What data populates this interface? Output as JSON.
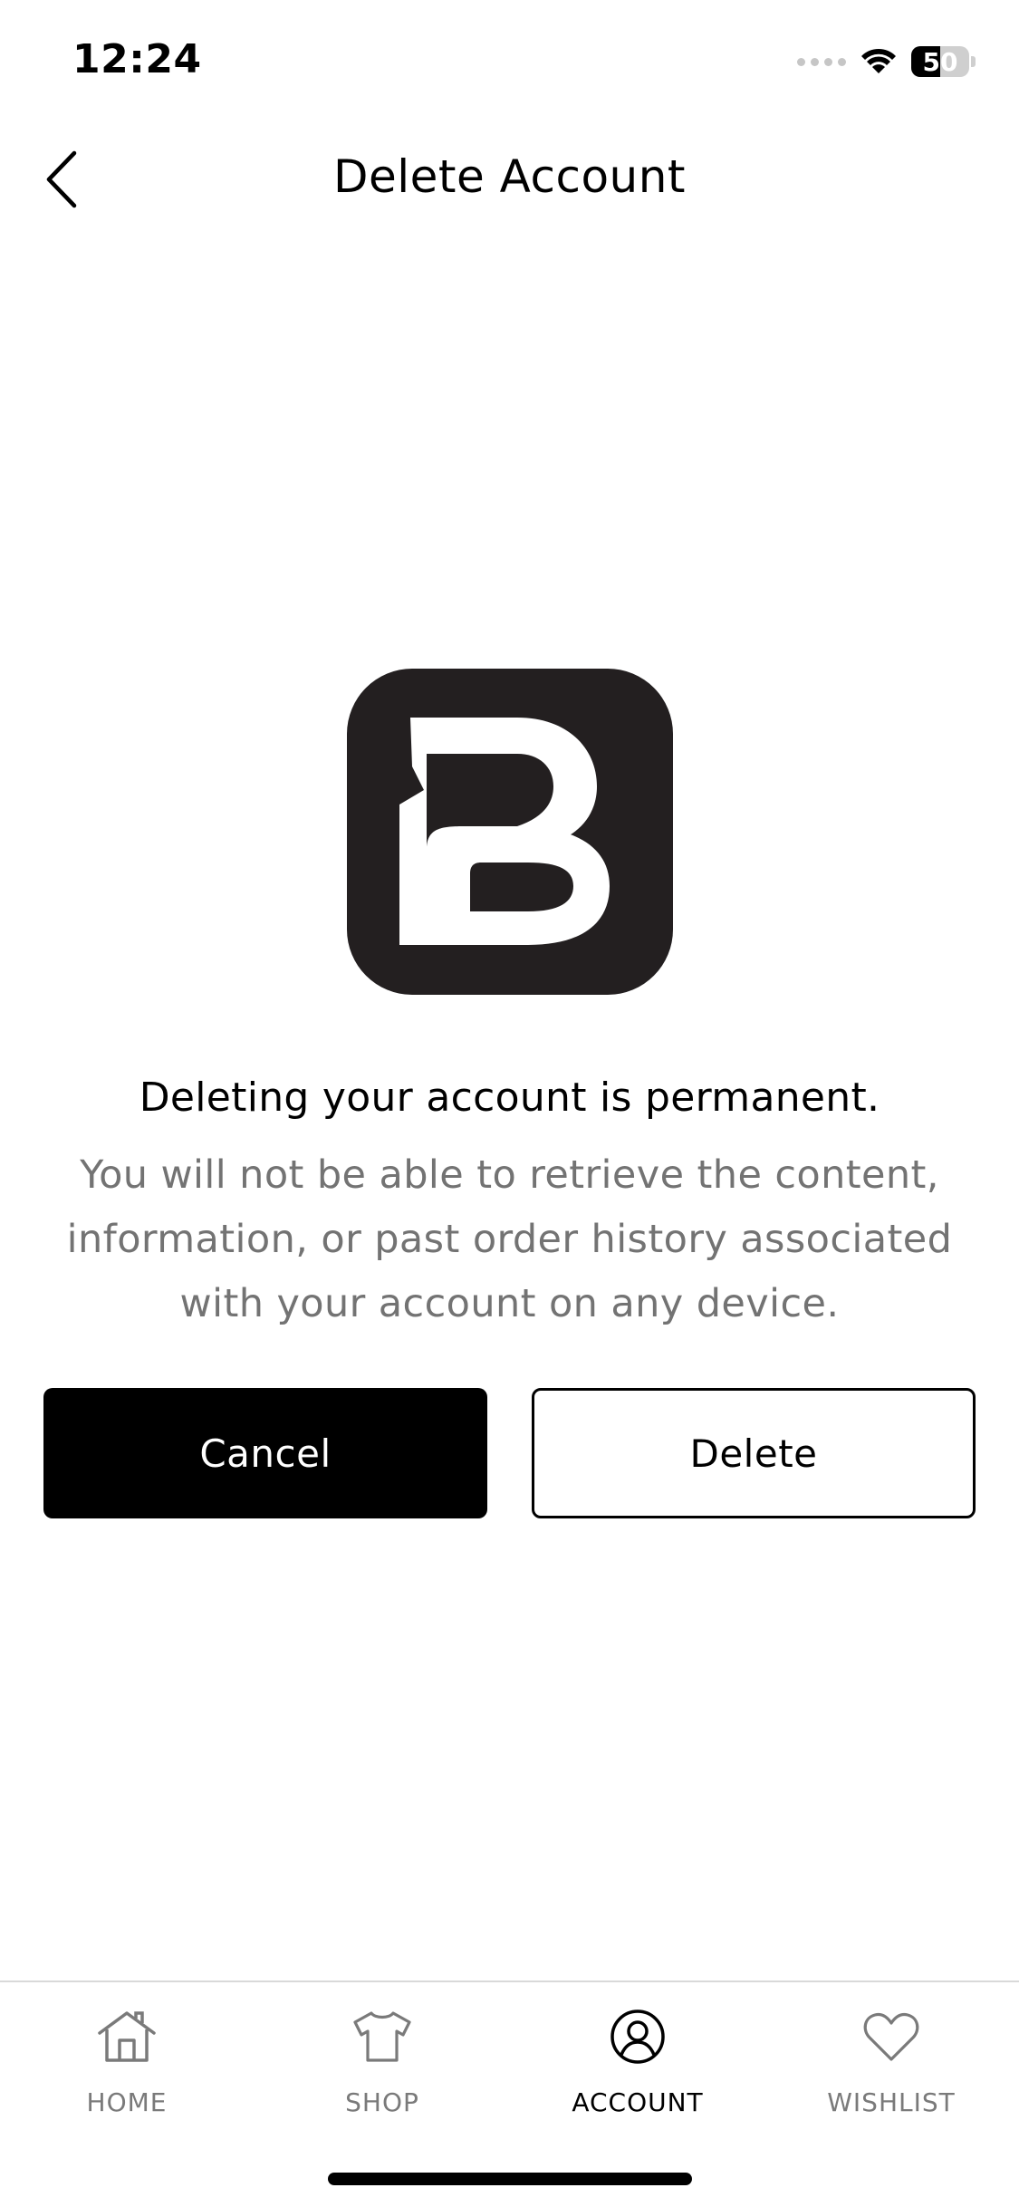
{
  "status_bar": {
    "time": "12:24",
    "battery_level": "50",
    "battery_fraction": 0.5
  },
  "header": {
    "title": "Delete Account",
    "back_icon": "chevron-left-icon"
  },
  "logo": {
    "icon": "brand-b-logo",
    "background_color": "#231f20"
  },
  "message": {
    "headline": "Deleting your account is permanent.",
    "description": "You will not be able to retrieve the content, information, or past order history associated with your account on any device."
  },
  "actions": {
    "cancel_label": "Cancel",
    "delete_label": "Delete"
  },
  "tab_bar": {
    "items": [
      {
        "label": "HOME",
        "icon": "house-icon",
        "active": false
      },
      {
        "label": "SHOP",
        "icon": "tshirt-icon",
        "active": false
      },
      {
        "label": "ACCOUNT",
        "icon": "user-circle-icon",
        "active": true
      },
      {
        "label": "WISHLIST",
        "icon": "heart-icon",
        "active": false
      }
    ]
  },
  "colors": {
    "primary": "#000000",
    "muted_text": "#737373",
    "inactive_tab": "#7a7a7a"
  }
}
